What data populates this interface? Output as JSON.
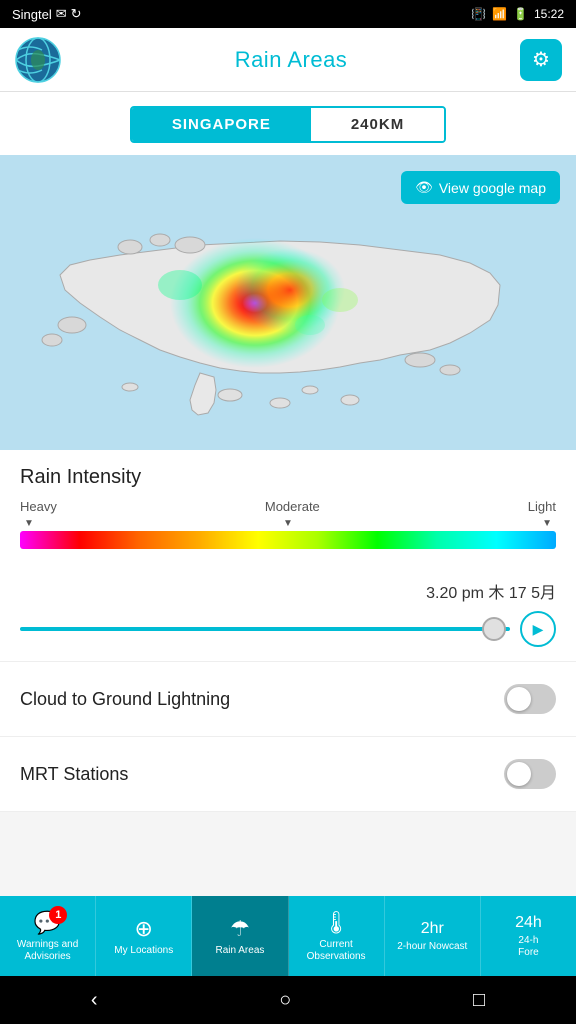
{
  "statusBar": {
    "carrier": "Singtel",
    "time": "15:22"
  },
  "header": {
    "title": "Rain Areas",
    "gearIcon": "⚙"
  },
  "viewToggle": {
    "option1": "SINGAPORE",
    "option2": "240KM",
    "active": "SINGAPORE"
  },
  "mapButton": {
    "label": "View google map",
    "icon": "👁"
  },
  "rainIntensity": {
    "title": "Rain Intensity",
    "labelHeavy": "Heavy",
    "labelModerate": "Moderate",
    "labelLight": "Light"
  },
  "timeSlider": {
    "timeLabel": "3.20 pm 木 17 5月"
  },
  "cloudLightning": {
    "label": "Cloud to Ground Lightning"
  },
  "mrtStations": {
    "label": "MRT Stations"
  },
  "bottomNav": {
    "items": [
      {
        "id": "warnings",
        "icon": "💬",
        "label": "Warnings and\nAdvisories",
        "badge": 1
      },
      {
        "id": "my-locations",
        "icon": "◎",
        "label": "My Locations",
        "badge": null
      },
      {
        "id": "rain-areas",
        "icon": "☂",
        "label": "Rain Areas",
        "badge": null
      },
      {
        "id": "current-obs",
        "icon": "🌡",
        "label": "Current\nObservations",
        "badge": null
      },
      {
        "id": "2hr-nowcast",
        "icon": "⏱",
        "label": "2-hour Nowcast",
        "badge": null
      },
      {
        "id": "24hr-fore",
        "icon": "☁",
        "label": "24-h\nFore",
        "badge": null
      }
    ]
  },
  "systemBar": {
    "backIcon": "‹",
    "homeIcon": "○",
    "recentIcon": "□"
  }
}
